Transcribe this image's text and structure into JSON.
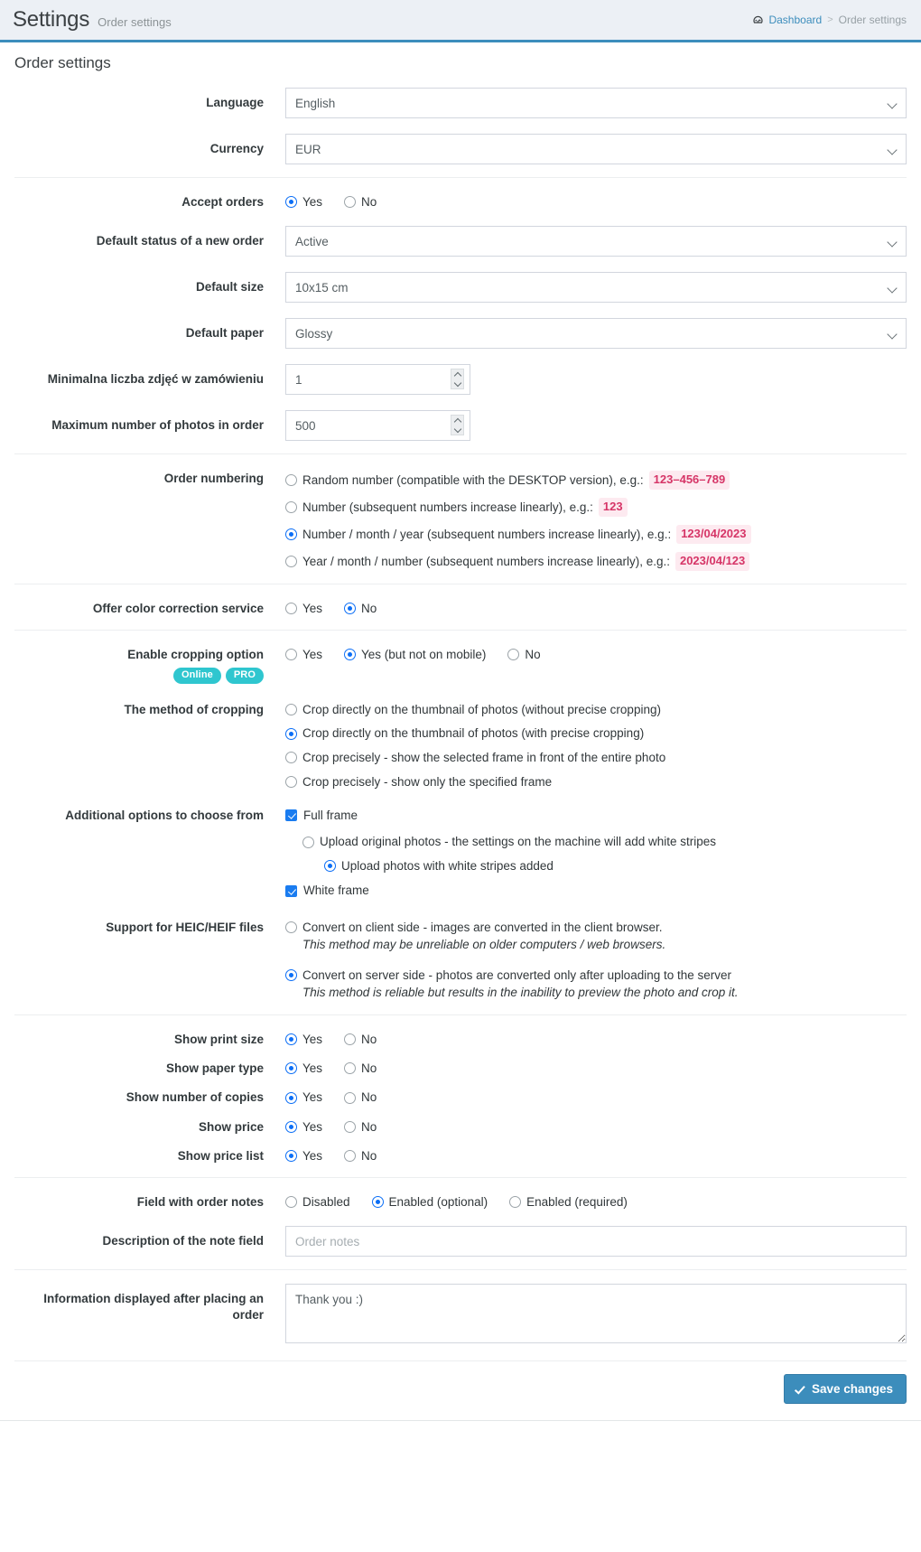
{
  "header": {
    "title": "Settings",
    "subtitle": "Order settings",
    "breadcrumb": {
      "home_icon": "dashboard-icon",
      "home": "Dashboard",
      "separator": ">",
      "current": "Order settings"
    }
  },
  "box": {
    "heading": "Order settings"
  },
  "localization": {
    "language": {
      "label": "Language",
      "value": "English"
    },
    "currency": {
      "label": "Currency",
      "value": "EUR"
    }
  },
  "orders": {
    "accept_orders": {
      "label": "Accept orders",
      "yes": "Yes",
      "no": "No",
      "selected": "Yes"
    },
    "default_status": {
      "label": "Default status of a new order",
      "value": "Active"
    },
    "default_size": {
      "label": "Default size",
      "value": "10x15 cm"
    },
    "default_paper": {
      "label": "Default paper",
      "value": "Glossy"
    },
    "min_photos": {
      "label": "Minimalna liczba zdjęć w zamówieniu",
      "value": "1"
    },
    "max_photos": {
      "label": "Maximum number of photos in order",
      "value": "500"
    }
  },
  "numbering": {
    "label": "Order numbering",
    "options": [
      {
        "text": "Random number (compatible with the DESKTOP version), e.g.:",
        "example": "123–456–789",
        "selected": false
      },
      {
        "text": "Number (subsequent numbers increase linearly), e.g.:",
        "example": "123",
        "selected": false
      },
      {
        "text": "Number / month / year (subsequent numbers increase linearly), e.g.:",
        "example": "123/04/2023",
        "selected": true
      },
      {
        "text": "Year / month / number (subsequent numbers increase linearly), e.g.:",
        "example": "2023/04/123",
        "selected": false
      }
    ]
  },
  "color_correction": {
    "label": "Offer color correction service",
    "yes": "Yes",
    "no": "No",
    "selected": "No"
  },
  "cropping": {
    "enable": {
      "label": "Enable cropping option",
      "badges": [
        "Online",
        "PRO"
      ],
      "options": [
        "Yes",
        "Yes (but not on mobile)",
        "No"
      ],
      "selected": "Yes (but not on mobile)"
    },
    "method": {
      "label": "The method of cropping",
      "options": [
        "Crop directly on the thumbnail of photos (without precise cropping)",
        "Crop directly on the thumbnail of photos (with precise cropping)",
        "Crop precisely - show the selected frame in front of the entire photo",
        "Crop precisely - show only the specified frame"
      ],
      "selected": "Crop directly on the thumbnail of photos (with precise cropping)"
    },
    "additional": {
      "label": "Additional options to choose from",
      "full_frame": {
        "label": "Full frame",
        "checked": true
      },
      "sub_options": [
        {
          "label": "Upload original photos - the settings on the machine will add white stripes",
          "selected": false
        },
        {
          "label": "Upload photos with white stripes added",
          "selected": true
        }
      ],
      "white_frame": {
        "label": "White frame",
        "checked": true
      }
    },
    "heic": {
      "label": "Support for HEIC/HEIF files",
      "options": [
        {
          "main": "Convert on client side - images are converted in the client browser.",
          "note": "This method may be unreliable on older computers / web browsers.",
          "selected": false
        },
        {
          "main": "Convert on server side - photos are converted only after uploading to the server",
          "note": "This method is reliable but results in the inability to preview the photo and crop it.",
          "selected": true
        }
      ]
    }
  },
  "display": {
    "yes": "Yes",
    "no": "No",
    "rows": [
      {
        "label": "Show print size",
        "selected": "Yes"
      },
      {
        "label": "Show paper type",
        "selected": "Yes"
      },
      {
        "label": "Show number of copies",
        "selected": "Yes"
      },
      {
        "label": "Show price",
        "selected": "Yes"
      },
      {
        "label": "Show price list",
        "selected": "Yes"
      }
    ]
  },
  "notes": {
    "field": {
      "label": "Field with order notes",
      "options": [
        "Disabled",
        "Enabled (optional)",
        "Enabled (required)"
      ],
      "selected": "Enabled (optional)"
    },
    "description": {
      "label": "Description of the note field",
      "value": "",
      "placeholder": "Order notes"
    }
  },
  "after_order": {
    "label": "Information displayed after placing an order",
    "value": "Thank you :)"
  },
  "footer": {
    "save_label": "Save changes",
    "save_icon": "check-icon"
  },
  "colors": {
    "accent": "#3c8dbc",
    "radio": "#0b6ef6",
    "badge": "#2fc6cf",
    "code_text": "#d63567",
    "code_bg": "#fdeaf0",
    "header_bg": "#ecf0f5"
  }
}
